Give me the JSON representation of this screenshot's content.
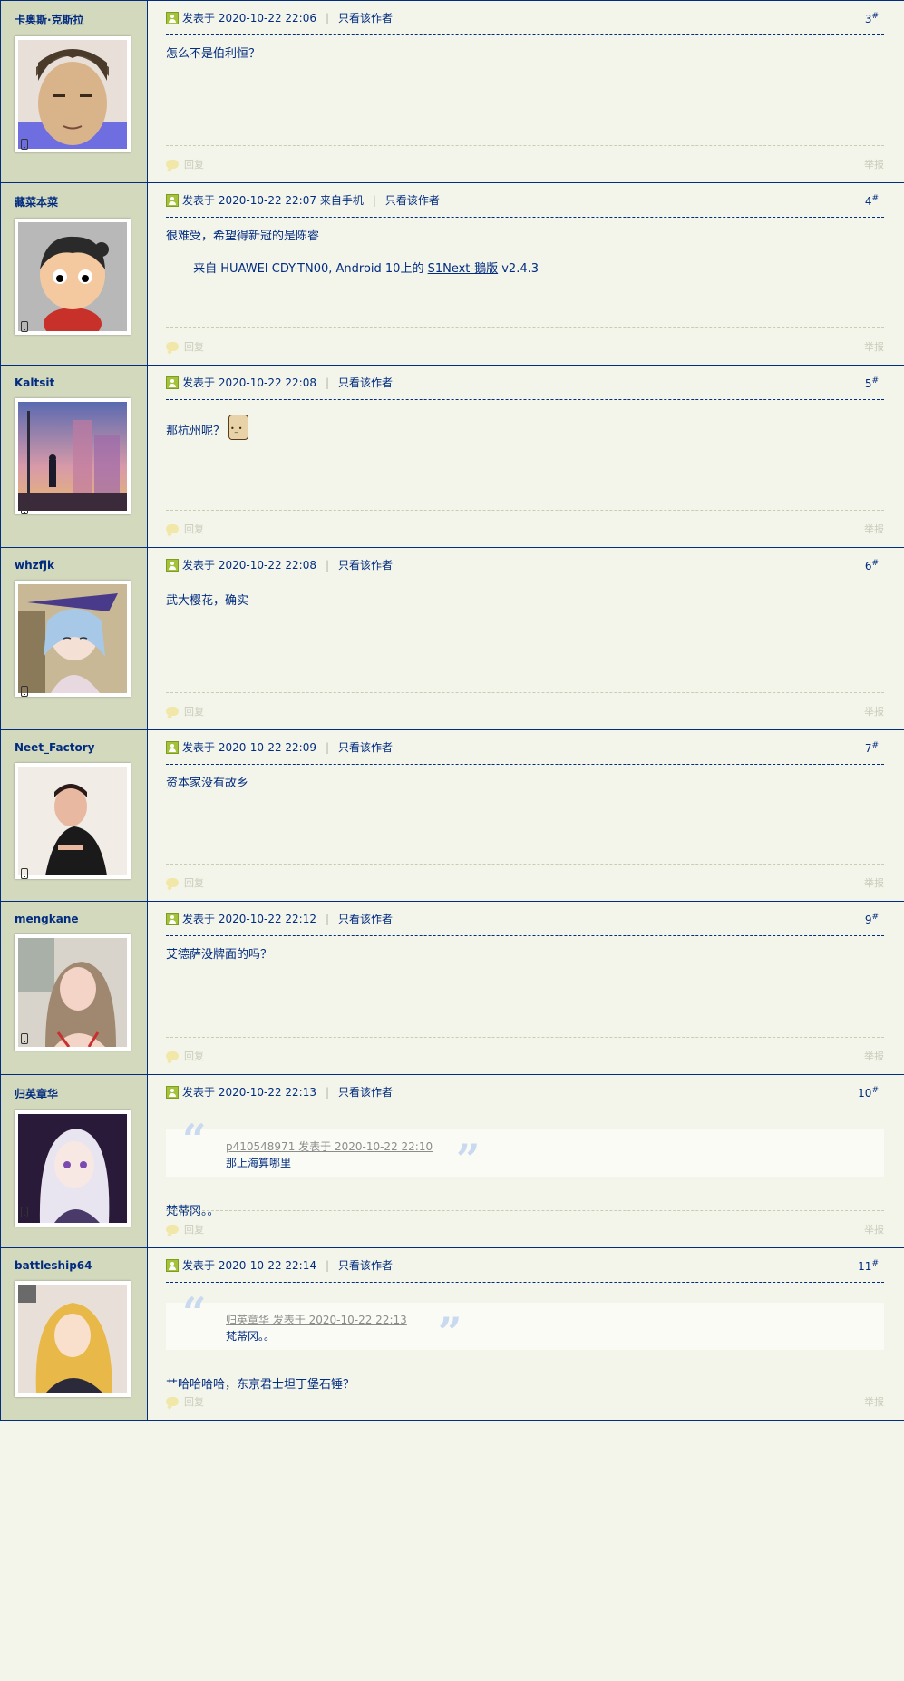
{
  "labels": {
    "posted_at": "发表于",
    "only_author": "只看该作者",
    "from_mobile": "来自手机",
    "reply": "回复",
    "report": "举报",
    "floor_suffix": "#"
  },
  "posts": [
    {
      "author": "卡奥斯·克斯拉",
      "time": "2020-10-22 22:06",
      "floor": "3",
      "text": "怎么不是伯利恒？"
    },
    {
      "author": "藏菜本菜",
      "time": "2020-10-22 22:07",
      "floor": "4",
      "text": "很难受，希望得新冠的是陈睿",
      "signature": {
        "prefix": "—— 来自 HUAWEI CDY-TN00, Android 10上的",
        "link": "S1Next-鵝版",
        "suffix": "v2.4.3"
      }
    },
    {
      "author": "Kaltsit",
      "time": "2020-10-22 22:08",
      "floor": "5",
      "text": "那杭州呢？"
    },
    {
      "author": "whzfjk",
      "time": "2020-10-22 22:08",
      "floor": "6",
      "text": "武大樱花，确实"
    },
    {
      "author": "Neet_Factory",
      "time": "2020-10-22 22:09",
      "floor": "7",
      "text": "资本家没有故乡"
    },
    {
      "author": "mengkane",
      "time": "2020-10-22 22:12",
      "floor": "9",
      "text": "艾德萨没牌面的吗？"
    },
    {
      "author": "归英章华",
      "time": "2020-10-22 22:13",
      "floor": "10",
      "text": "梵蒂冈。。",
      "quote": {
        "source": "p410548971 发表于 2020-10-22 22:10",
        "text": "那上海算哪里"
      }
    },
    {
      "author": "battleship64",
      "time": "2020-10-22 22:14",
      "floor": "11",
      "text": "艹哈哈哈哈，东京君士坦丁堡石锤？",
      "quote": {
        "source": "归英章华 发表于 2020-10-22 22:13",
        "text": "梵蒂冈。。"
      }
    }
  ]
}
